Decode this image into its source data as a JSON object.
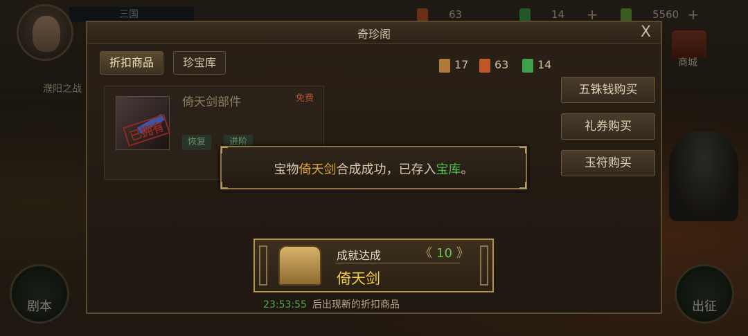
{
  "hud": {
    "stage_top": "三国",
    "stage_name": "濮阳之战",
    "res1_value": "63",
    "res2_value": "14",
    "res3_value": "5560",
    "plus": "+",
    "shop_label": "商城",
    "script_label": "剧本",
    "expedition_label": "出征"
  },
  "panel": {
    "title": "奇珍阁",
    "close": "X",
    "tabs": [
      {
        "label": "折扣商品",
        "active": true
      },
      {
        "label": "珍宝库",
        "active": false
      }
    ],
    "currencies": [
      {
        "icon": "scroll-coin-icon",
        "value": "17",
        "color": "#b07a3a"
      },
      {
        "icon": "gift-ticket-icon",
        "value": "63",
        "color": "#c0582a"
      },
      {
        "icon": "jade-tally-icon",
        "value": "14",
        "color": "#3fa04a"
      }
    ],
    "buy_buttons": [
      "五铢钱购买",
      "礼券购买",
      "玉符购买"
    ],
    "product": {
      "name": "倚天剑部件",
      "free_tag": "免费",
      "stamp": "已拥有",
      "btn1": "恢复",
      "btn2": "进阶"
    },
    "timer": {
      "time": "23:53:55",
      "text": "后出现新的折扣商品"
    }
  },
  "toast": {
    "prefix": "宝物",
    "item": "倚天剑",
    "middle": "合成成功，已存入",
    "place": "宝库",
    "suffix": "。"
  },
  "achievement": {
    "title": "成就达成",
    "level": "10",
    "left_arrow": "《",
    "right_arrow": "》",
    "name": "倚天剑",
    "icon": "treasure-chest-icon"
  }
}
